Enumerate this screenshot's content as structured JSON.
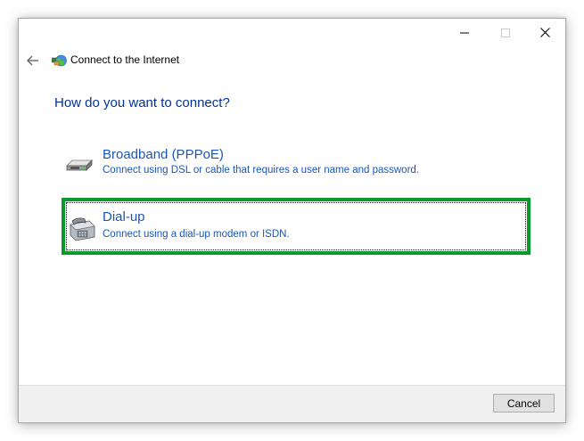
{
  "window": {
    "title": "Connect to the Internet"
  },
  "icons": {
    "back": "back-arrow-icon",
    "app": "network-globe-icon",
    "broadband": "broadband-modem-icon",
    "dialup": "dialup-phone-icon",
    "minimize": "minimize-icon",
    "maximize": "maximize-icon",
    "close": "close-icon"
  },
  "main": {
    "heading": "How do you want to connect?",
    "options": [
      {
        "title": "Broadband (PPPoE)",
        "description": "Connect using DSL or cable that requires a user name and password."
      },
      {
        "title": "Dial-up",
        "description": "Connect using a dial-up modem or ISDN."
      }
    ]
  },
  "footer": {
    "cancel_label": "Cancel"
  },
  "colors": {
    "heading": "#003399",
    "link": "#1a56b8",
    "highlight": "#0a9a2c",
    "footer_bg": "#f0f0f0"
  }
}
